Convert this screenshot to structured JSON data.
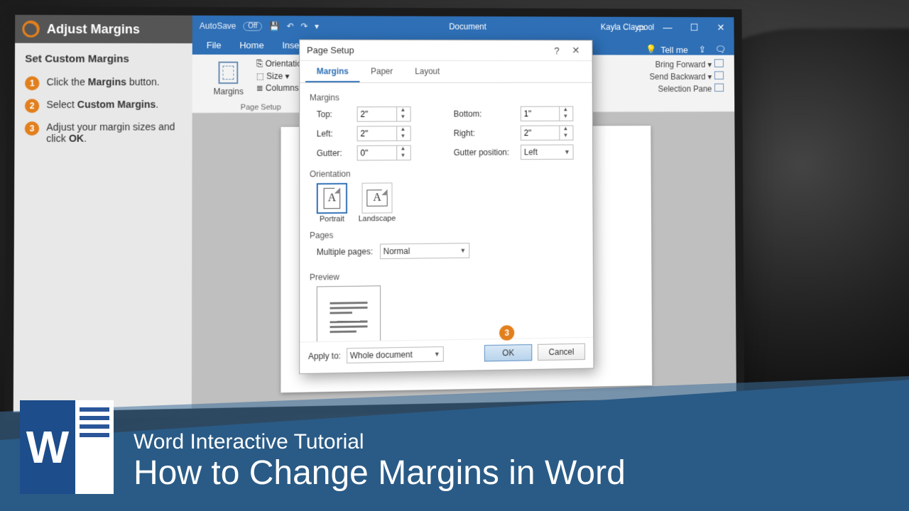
{
  "guide": {
    "header": "Adjust Margins",
    "subhead": "Set Custom Margins",
    "steps": [
      {
        "num": "1",
        "html": "Click the <strong>Margins</strong> button."
      },
      {
        "num": "2",
        "html": "Select <strong>Custom Margins</strong>."
      },
      {
        "num": "3",
        "html": "Adjust your margin sizes and click <strong>OK</strong>."
      }
    ]
  },
  "word": {
    "autosave": "AutoSave",
    "autosave_state": "Off",
    "doc": "Document",
    "user": "Kayla Claypool",
    "tabs": [
      "File",
      "Home",
      "Insert"
    ],
    "tellme": "Tell me",
    "ribbon": {
      "margins": "Margins",
      "orientation": "Orientation",
      "size": "Size",
      "columns": "Columns",
      "group": "Page Setup",
      "right_items": [
        "Bring Forward",
        "Send Backward",
        "Selection Pane"
      ]
    }
  },
  "dialog": {
    "title": "Page Setup",
    "tabs": [
      "Margins",
      "Paper",
      "Layout"
    ],
    "section_margins": "Margins",
    "top_lbl": "Top:",
    "top_val": "2\"",
    "bottom_lbl": "Bottom:",
    "bottom_val": "1\"",
    "left_lbl": "Left:",
    "left_val": "2\"",
    "right_lbl": "Right:",
    "right_val": "2\"",
    "gutter_lbl": "Gutter:",
    "gutter_val": "0\"",
    "gutpos_lbl": "Gutter position:",
    "gutpos_val": "Left",
    "section_orientation": "Orientation",
    "portrait": "Portrait",
    "landscape": "Landscape",
    "section_pages": "Pages",
    "mpages_lbl": "Multiple pages:",
    "mpages_val": "Normal",
    "section_preview": "Preview",
    "apply_lbl": "Apply to:",
    "apply_val": "Whole document",
    "ok": "OK",
    "cancel": "Cancel",
    "pin": "3"
  },
  "caption": {
    "line1": "Word Interactive Tutorial",
    "line2": "How to Change Margins in Word",
    "wletter": "W"
  }
}
